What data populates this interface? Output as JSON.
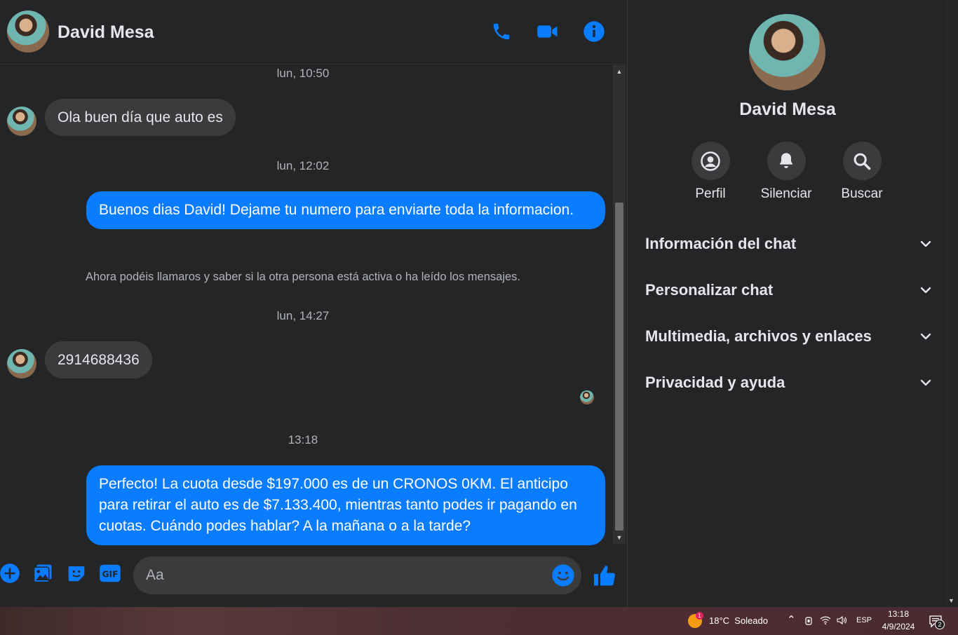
{
  "contact": {
    "name": "David Mesa"
  },
  "messages": [
    {
      "type": "timestamp",
      "text": "lun, 10:50"
    },
    {
      "type": "incoming",
      "text": "Ola buen día que auto es"
    },
    {
      "type": "timestamp",
      "text": "lun, 12:02"
    },
    {
      "type": "outgoing",
      "text": "Buenos dias David! Dejame tu numero para enviarte toda la informacion."
    },
    {
      "type": "system",
      "text": "Ahora podéis llamaros y saber si la otra persona está activa o ha leído los mensajes."
    },
    {
      "type": "timestamp",
      "text": "lun, 14:27"
    },
    {
      "type": "incoming",
      "text": "2914688436"
    },
    {
      "type": "timestamp",
      "text": "13:18"
    },
    {
      "type": "outgoing",
      "text": "Perfecto! La cuota desde $197.000 es de un CRONOS 0KM. El anticipo para retirar el auto es de $7.133.400, mientras tanto podes ir pagando en cuotas. Cuándo podes hablar? A la mañana o a la tarde?"
    }
  ],
  "composer": {
    "placeholder": "Aa"
  },
  "info_panel": {
    "actions": [
      {
        "label": "Perfil",
        "icon": "profile-icon"
      },
      {
        "label": "Silenciar",
        "icon": "bell-icon"
      },
      {
        "label": "Buscar",
        "icon": "search-icon"
      }
    ],
    "sections": [
      {
        "label": "Información del chat"
      },
      {
        "label": "Personalizar chat"
      },
      {
        "label": "Multimedia, archivos y enlaces"
      },
      {
        "label": "Privacidad y ayuda"
      }
    ]
  },
  "taskbar": {
    "weather_badge": "1",
    "weather": "18°C  Soleado",
    "language": "ESP",
    "time": "13:18",
    "date": "4/9/2024",
    "notifications": "2"
  },
  "colors": {
    "accent": "#0a7cff",
    "background": "#242526",
    "incoming_bubble": "#3a3b3c"
  }
}
